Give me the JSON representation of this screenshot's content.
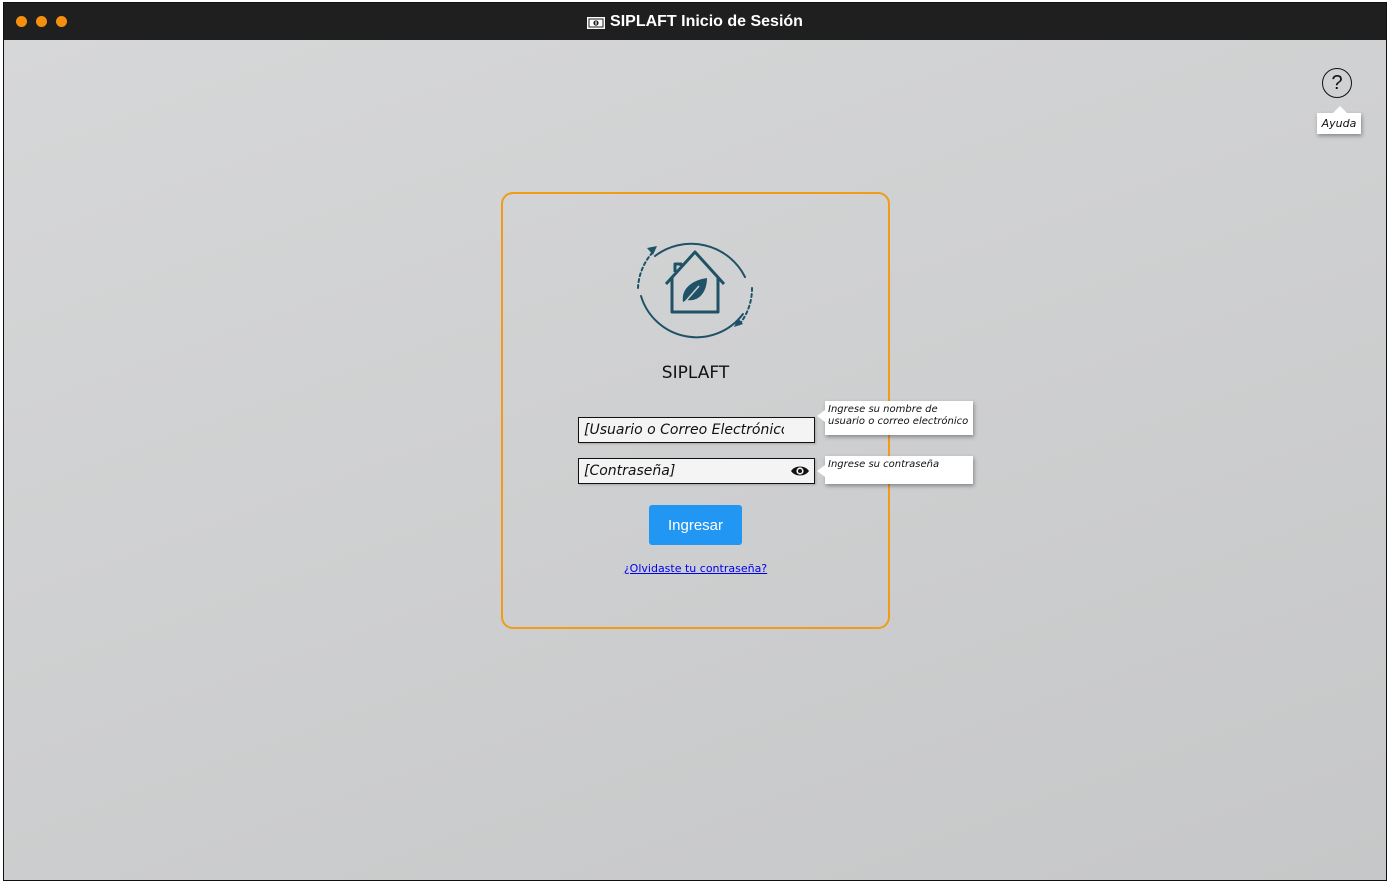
{
  "window": {
    "title": "SIPLAFT Inicio de Sesión",
    "title_icon": "money-icon",
    "controls": [
      "close-dot",
      "minimize-dot",
      "maximize-dot"
    ],
    "accent_color": "#f5900f"
  },
  "help": {
    "icon_label": "?",
    "tooltip": "Ayuda"
  },
  "login": {
    "logo_icon": "eco-house-icon",
    "app_name": "SIPLAFT",
    "username": {
      "placeholder": "[Usuario o Correo Electrónico]",
      "value": "",
      "tooltip": "Ingrese su nombre de usuario o correo electrónico"
    },
    "password": {
      "placeholder": "[Contraseña]",
      "value": "",
      "tooltip": "Ingrese su contraseña",
      "toggle_icon": "eye-icon"
    },
    "submit_label": "Ingresar",
    "forgot_link": "¿Olvidaste tu contraseña?",
    "border_color": "#f29b18",
    "button_color": "#2196f3"
  }
}
